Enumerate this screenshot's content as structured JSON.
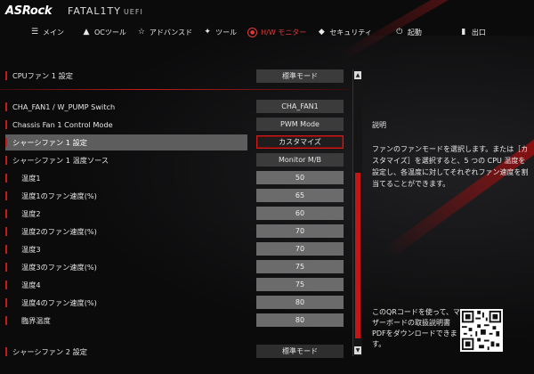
{
  "brand": {
    "logo": "ASRock",
    "series": "FATAL1TY",
    "firmware": "UEFI"
  },
  "nav": [
    {
      "label": "メイン",
      "icon": "menu-icon"
    },
    {
      "label": "OCツール",
      "icon": "flame-icon"
    },
    {
      "label": "アドバンスド",
      "icon": "star-icon"
    },
    {
      "label": "ツール",
      "icon": "wrench-icon"
    },
    {
      "label": "H/W モニター",
      "icon": "monitor-icon",
      "active": true
    },
    {
      "label": "セキュリティ",
      "icon": "shield-icon"
    },
    {
      "label": "起動",
      "icon": "power-icon"
    },
    {
      "label": "出口",
      "icon": "exit-icon"
    }
  ],
  "settings": {
    "cpu_fan1": {
      "label": "CPUファン 1 設定",
      "value": "標準モード"
    },
    "cha_fan1_pump": {
      "label": "CHA_FAN1 / W_PUMP Switch",
      "value": "CHA_FAN1"
    },
    "chassis_fan1_mode": {
      "label": "Chassis Fan 1 Control Mode",
      "value": "PWM Mode"
    },
    "chassis_fan1_setting": {
      "label": "シャーシファン 1 設定",
      "value": "カスタマイズ"
    },
    "chassis_fan1_temp_source": {
      "label": "シャーシファン 1 温度ソース",
      "value": "Monitor M/B"
    },
    "temp1": {
      "label": "温度1",
      "value": "50"
    },
    "temp1_fan": {
      "label": "温度1のファン速度(%)",
      "value": "65"
    },
    "temp2": {
      "label": "温度2",
      "value": "60"
    },
    "temp2_fan": {
      "label": "温度2のファン速度(%)",
      "value": "70"
    },
    "temp3": {
      "label": "温度3",
      "value": "70"
    },
    "temp3_fan": {
      "label": "温度3のファン速度(%)",
      "value": "75"
    },
    "temp4": {
      "label": "温度4",
      "value": "75"
    },
    "temp4_fan": {
      "label": "温度4のファン速度(%)",
      "value": "80"
    },
    "critical_temp": {
      "label": "臨界温度",
      "value": "80"
    },
    "chassis_fan2": {
      "label": "シャーシファン 2 設定",
      "value": "標準モード"
    }
  },
  "help": {
    "title": "説明",
    "body": "ファンのファンモードを選択します。または［カスタマイズ］を選択すると、5 つの CPU 温度を設定し、各温度に対してそれぞれファン速度を割当てることができます。",
    "qr_text": "このQRコードを使って、マザーボードの取扱説明書PDFをダウンロードできます。"
  },
  "colors": {
    "accent": "#c41b1b",
    "background": "#0b0b0c",
    "highlight_row": "#5d5d5d"
  }
}
